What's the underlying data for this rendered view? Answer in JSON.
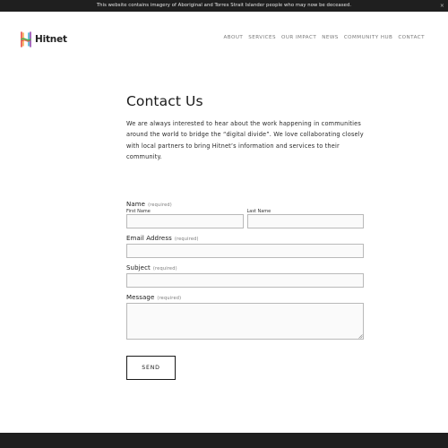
{
  "notice": {
    "text": "This website contains imagery of Aboriginal and Torres Strait Islander people who may now be deceased.",
    "close": "×"
  },
  "header": {
    "logo_text": "Hitnet",
    "logo_colors": [
      "#e8453c",
      "#f2a33a",
      "#4caf50",
      "#2aa7c9",
      "#8e44ad"
    ],
    "nav": [
      "About",
      "Services",
      "Our Impact",
      "News",
      "Community Hub",
      "Contact"
    ]
  },
  "main": {
    "title": "Contact Us",
    "intro": "We are always interested to hear about the work happening in communities around the world to bridge the “digital divide”. We love collaborating closely with local partners to bring Hitnet’s information and services to their community."
  },
  "form": {
    "required_text": "(required)",
    "name": {
      "label": "Name",
      "first_label": "First Name",
      "first_value": "",
      "last_label": "Last Name",
      "last_value": ""
    },
    "email": {
      "label": "Email Address",
      "value": ""
    },
    "subject": {
      "label": "Subject",
      "value": ""
    },
    "message": {
      "label": "Message",
      "value": ""
    },
    "submit_label": "Send"
  },
  "colors": {
    "notice_bg": "#1f1f1f",
    "footer_bg": "#1f1f1f",
    "input_border": "#b9b9b9",
    "nav_text": "#7a7a7a"
  }
}
